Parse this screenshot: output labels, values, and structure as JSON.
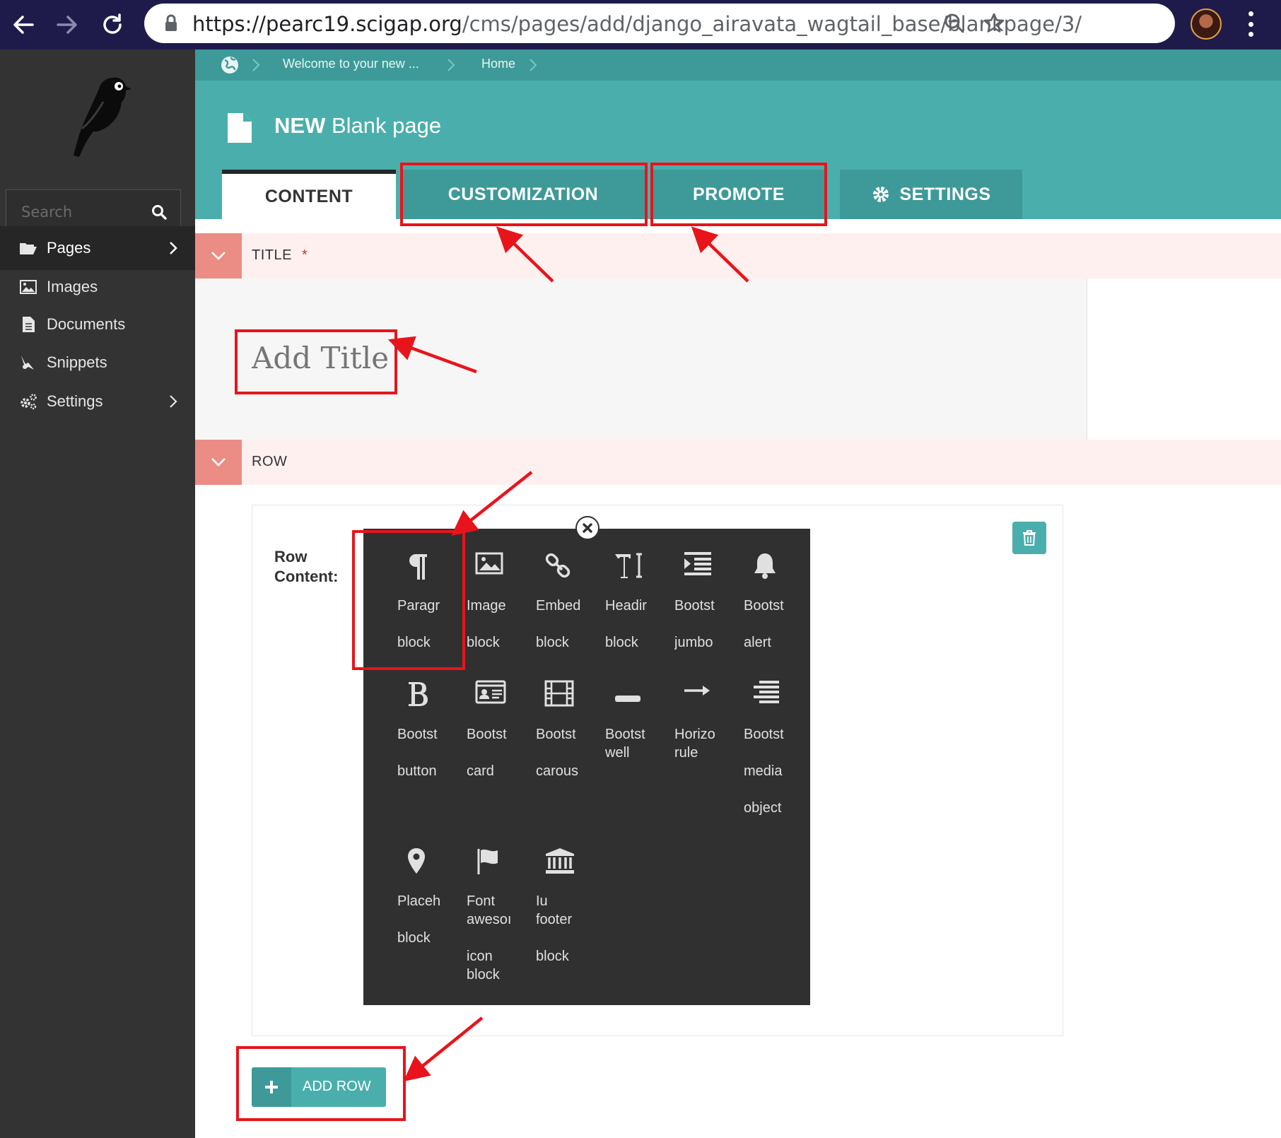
{
  "browser": {
    "url_host": "https://pearc19.scigap.org",
    "url_path": "/cms/pages/add/django_airavata_wagtail_base/blankpage/3/"
  },
  "sidebar": {
    "search_placeholder": "Search",
    "items": [
      {
        "label": "Pages",
        "icon": "folder-open-icon",
        "chevron": true,
        "active": true
      },
      {
        "label": "Images",
        "icon": "image-icon",
        "chevron": false
      },
      {
        "label": "Documents",
        "icon": "document-icon",
        "chevron": false
      },
      {
        "label": "Snippets",
        "icon": "snippet-icon",
        "chevron": false
      },
      {
        "label": "Settings",
        "icon": "cogs-icon",
        "chevron": true
      }
    ]
  },
  "breadcrumb": [
    "Welcome to your new ...",
    "Home"
  ],
  "header": {
    "title_prefix": "NEW",
    "title": "Blank page"
  },
  "tabs": [
    {
      "label": "CONTENT",
      "active": true
    },
    {
      "label": "CUSTOMIZATION"
    },
    {
      "label": "PROMOTE"
    },
    {
      "label": "SETTINGS",
      "icon": "gear-icon"
    }
  ],
  "title_section": {
    "label": "TITLE",
    "required_mark": "*",
    "placeholder": "Add Title"
  },
  "row_section": {
    "label": "ROW",
    "row_content_label_1": "Row",
    "row_content_label_2": "Content:"
  },
  "blocks": [
    {
      "lines": [
        "Paragr",
        "",
        "block"
      ],
      "icon": "paragraph-icon"
    },
    {
      "lines": [
        "Image",
        "",
        "block"
      ],
      "icon": "image-icon"
    },
    {
      "lines": [
        "Embed",
        "",
        "block"
      ],
      "icon": "link-icon"
    },
    {
      "lines": [
        "Headir",
        "",
        "block"
      ],
      "icon": "heading-icon"
    },
    {
      "lines": [
        "Bootst",
        "",
        "jumbo"
      ],
      "icon": "indent-icon"
    },
    {
      "lines": [
        "Bootst",
        "",
        "alert"
      ],
      "icon": "bell-icon"
    },
    {
      "lines": [
        "Bootst",
        "",
        "button"
      ],
      "icon": "bold-icon"
    },
    {
      "lines": [
        "Bootst",
        "",
        "card"
      ],
      "icon": "id-card-icon"
    },
    {
      "lines": [
        "Bootst",
        "",
        "carous"
      ],
      "icon": "film-icon"
    },
    {
      "lines": [
        "Bootst",
        "well"
      ],
      "icon": "minus-icon"
    },
    {
      "lines": [
        "Horizo",
        "rule"
      ],
      "icon": "arrow-right-icon"
    },
    {
      "lines": [
        "Bootst",
        "",
        "media",
        "",
        "object"
      ],
      "icon": "align-justify-icon"
    },
    {
      "lines": [
        "Placeh",
        "",
        "block"
      ],
      "icon": "map-marker-icon"
    },
    {
      "lines": [
        "Font",
        "awesoı",
        "",
        "icon",
        "block"
      ],
      "icon": "flag-icon"
    },
    {
      "lines": [
        "Iu",
        "footer",
        "",
        "block"
      ],
      "icon": "university-icon"
    }
  ],
  "add_row_label": "ADD ROW",
  "colors": {
    "teal": "#4aafac",
    "teal_dark": "#3d9a98",
    "sidebar": "#333333",
    "annotation_red": "#e8141b",
    "section_bar": "#fdf0ef",
    "section_toggle": "#ec8d85"
  }
}
